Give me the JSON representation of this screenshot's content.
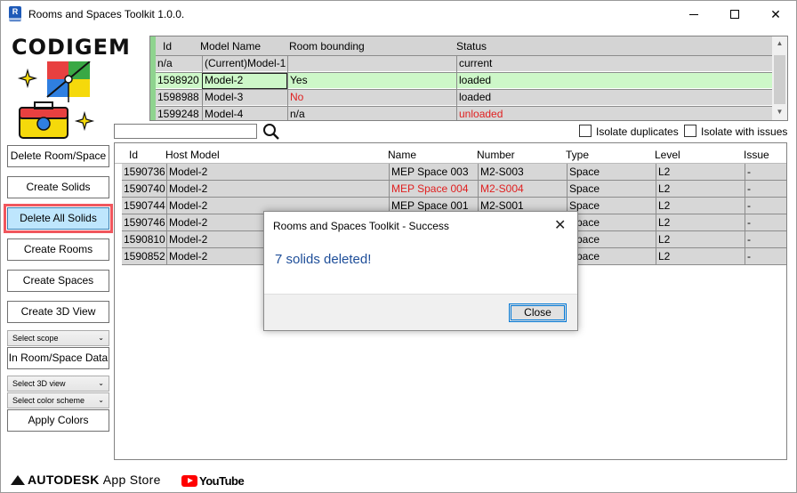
{
  "window": {
    "title": "Rooms and Spaces Toolkit 1.0.0.",
    "app_icon_letter": "R"
  },
  "logo": {
    "text": "CODIGEM"
  },
  "left_panel": {
    "buttons": [
      "Delete Room/Space",
      "Create Solids",
      "Delete All Solids",
      "Create Rooms",
      "Create Spaces",
      "Create 3D View"
    ],
    "active_button": "Delete All Solids",
    "scope_select": "Select scope",
    "in_data_button": "In Room/Space Data",
    "view_select": "Select 3D view",
    "color_select": "Select color scheme",
    "apply_colors_button": "Apply Colors"
  },
  "models_grid": {
    "headers": [
      "Id",
      "Model Name",
      "Room bounding",
      "Status"
    ],
    "rows": [
      {
        "id": "n/a",
        "name": "(Current)Model-1",
        "bounding": "",
        "status": "current"
      },
      {
        "id": "1598920",
        "name": "Model-2",
        "bounding": "Yes",
        "status": "loaded"
      },
      {
        "id": "1598988",
        "name": "Model-3",
        "bounding": "No",
        "status": "loaded"
      },
      {
        "id": "1599248",
        "name": "Model-4",
        "bounding": "n/a",
        "status": "unloaded"
      }
    ]
  },
  "filters": {
    "search_value": "",
    "isolate_duplicates": "Isolate duplicates",
    "isolate_issues": "Isolate with issues"
  },
  "spaces_grid": {
    "headers": [
      "Id",
      "Host Model",
      "Name",
      "Number",
      "Type",
      "Level",
      "Issue"
    ],
    "rows": [
      {
        "id": "1590736",
        "host": "Model-2",
        "name": "MEP Space 003",
        "number": "M2-S003",
        "type": "Space",
        "level": "L2",
        "issue": "-"
      },
      {
        "id": "1590740",
        "host": "Model-2",
        "name": "MEP Space 004",
        "number": "M2-S004",
        "type": "Space",
        "level": "L2",
        "issue": "-"
      },
      {
        "id": "1590744",
        "host": "Model-2",
        "name": "MEP Space 001",
        "number": "M2-S001",
        "type": "Space",
        "level": "L2",
        "issue": "-"
      },
      {
        "id": "1590746",
        "host": "Model-2",
        "name": "",
        "number": "",
        "type": "Space",
        "level": "L2",
        "issue": "-"
      },
      {
        "id": "1590810",
        "host": "Model-2",
        "name": "",
        "number": "",
        "type": "Space",
        "level": "L2",
        "issue": "-"
      },
      {
        "id": "1590852",
        "host": "Model-2",
        "name": "",
        "number": "",
        "type": "Space",
        "level": "L2",
        "issue": "-"
      }
    ]
  },
  "dialog": {
    "title": "Rooms and Spaces Toolkit - Success",
    "message": "7 solids deleted!",
    "close_button": "Close"
  },
  "footer": {
    "autodesk": "AUTODESK",
    "store": "App Store",
    "youtube": "YouTube"
  },
  "colors": {
    "accent_red": "#e02020",
    "highlight_outline": "#f1565d",
    "selected_row": "#cdf7c8",
    "dialog_message": "#1e4e99"
  }
}
